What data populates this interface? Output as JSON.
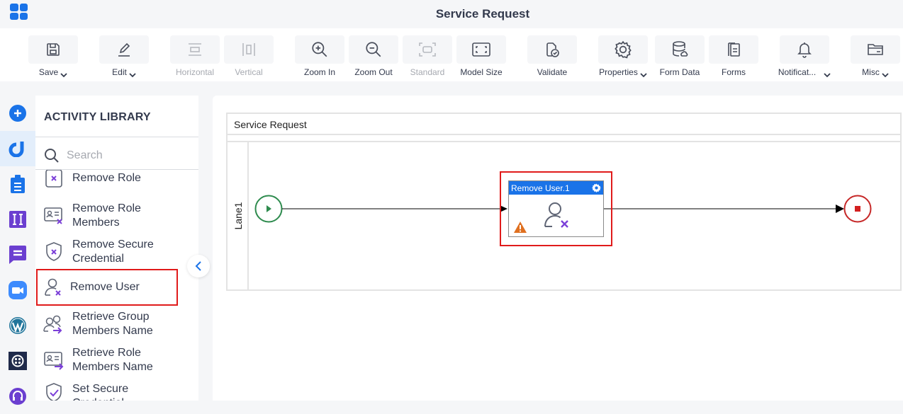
{
  "header": {
    "title": "Service Request",
    "app_menu_icon": "apps-grid-icon"
  },
  "toolbar": {
    "items": [
      {
        "label": "Save",
        "icon": "save-icon",
        "dropdown": true,
        "enabled": true
      },
      {
        "label": "Edit",
        "icon": "edit-icon",
        "dropdown": true,
        "enabled": true
      },
      {
        "label": "Horizontal",
        "icon": "horizontal-icon",
        "dropdown": false,
        "enabled": false
      },
      {
        "label": "Vertical",
        "icon": "vertical-icon",
        "dropdown": false,
        "enabled": false
      },
      {
        "label": "Zoom In",
        "icon": "zoom-in-icon",
        "dropdown": false,
        "enabled": true
      },
      {
        "label": "Zoom Out",
        "icon": "zoom-out-icon",
        "dropdown": false,
        "enabled": true
      },
      {
        "label": "Standard",
        "icon": "standard-icon",
        "dropdown": false,
        "enabled": false
      },
      {
        "label": "Model Size",
        "icon": "model-size-icon",
        "dropdown": false,
        "enabled": true
      },
      {
        "label": "Validate",
        "icon": "validate-icon",
        "dropdown": false,
        "enabled": true
      },
      {
        "label": "Properties",
        "icon": "gear-icon",
        "dropdown": true,
        "enabled": true
      },
      {
        "label": "Form Data",
        "icon": "database-icon",
        "dropdown": false,
        "enabled": true
      },
      {
        "label": "Forms",
        "icon": "forms-icon",
        "dropdown": false,
        "enabled": true
      },
      {
        "label": "Notificat...",
        "icon": "bell-icon",
        "dropdown": true,
        "enabled": true
      },
      {
        "label": "Misc",
        "icon": "folder-icon",
        "dropdown": true,
        "enabled": true
      }
    ]
  },
  "left_rail": {
    "items": [
      {
        "name": "add",
        "icon": "plus-circle-icon",
        "active": false
      },
      {
        "name": "activities",
        "icon": "activity-logo-icon",
        "active": true
      },
      {
        "name": "tasks",
        "icon": "clipboard-icon",
        "active": false
      },
      {
        "name": "integration",
        "icon": "ii-icon",
        "active": false
      },
      {
        "name": "messaging",
        "icon": "chat-icon",
        "active": false
      },
      {
        "name": "zoom",
        "icon": "video-camera-icon",
        "active": false
      },
      {
        "name": "wordpress",
        "icon": "wordpress-icon",
        "active": false
      },
      {
        "name": "twilio",
        "icon": "twilio-icon",
        "active": false
      },
      {
        "name": "support",
        "icon": "headset-icon",
        "active": false
      }
    ]
  },
  "library": {
    "title": "ACTIVITY LIBRARY",
    "search_placeholder": "Search",
    "search_value": "",
    "items": [
      {
        "label": "Remove Role",
        "icon": "remove-role-icon",
        "selected": false
      },
      {
        "label": "Remove Role Members",
        "icon": "remove-role-members-icon",
        "selected": false
      },
      {
        "label": "Remove Secure Credential",
        "icon": "remove-credential-icon",
        "selected": false
      },
      {
        "label": "Remove User",
        "icon": "remove-user-icon",
        "selected": true
      },
      {
        "label": "Retrieve Group Members Name",
        "icon": "retrieve-group-icon",
        "selected": false
      },
      {
        "label": "Retrieve Role Members Name",
        "icon": "retrieve-role-icon",
        "selected": false
      },
      {
        "label": "Set Secure Credential",
        "icon": "set-credential-icon",
        "selected": false
      }
    ],
    "collapse_icon": "chevron-left-icon"
  },
  "canvas": {
    "pool_title": "Service Request",
    "lane_label": "Lane1",
    "task": {
      "title": "Remove User.1",
      "warning": true
    },
    "colors": {
      "start": "#2e8b4e",
      "end": "#c62828",
      "task_header": "#1a73e8",
      "selection": "#e01b1b",
      "warning": "#e07020"
    }
  }
}
